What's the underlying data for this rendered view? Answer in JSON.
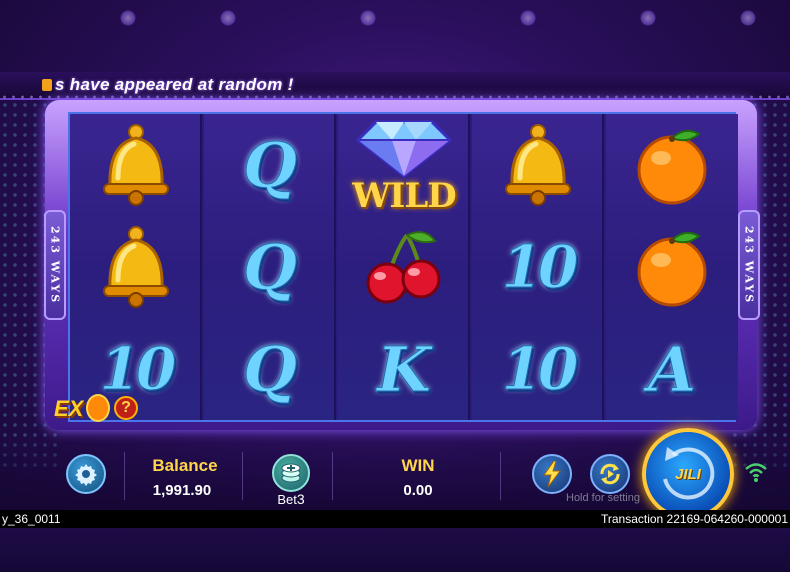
{
  "marquee": {
    "text": "s have appeared at random !"
  },
  "ways": {
    "left": "243 WAYS",
    "right": "243 WAYS"
  },
  "reels": [
    [
      "bell-icon",
      "bell-icon",
      "10"
    ],
    [
      "Q",
      "Q",
      "Q"
    ],
    [
      "wild-diamond-icon",
      "cherry-icon",
      "K"
    ],
    [
      "bell-icon",
      "10",
      "10"
    ],
    [
      "orange-icon",
      "orange-icon",
      "A"
    ]
  ],
  "wild": {
    "label": "WILD"
  },
  "ex_badge": {
    "text": "EX",
    "help": "?"
  },
  "bottom": {
    "balance_label": "Balance",
    "balance_value": "1,991.90",
    "bet_label": "Bet",
    "bet_value": "3",
    "win_label": "WIN",
    "win_value": "0.00",
    "hold_text": "Hold for setting",
    "spin_label": "JILI"
  },
  "footer": {
    "game_id": "y_36_0011",
    "transaction": "Transaction 22169-064260-000001"
  },
  "colors": {
    "accent_gold": "#ffd54a",
    "reel_symbol_blue": "#6fd3ff",
    "spin_button": "#0a4fb8"
  }
}
